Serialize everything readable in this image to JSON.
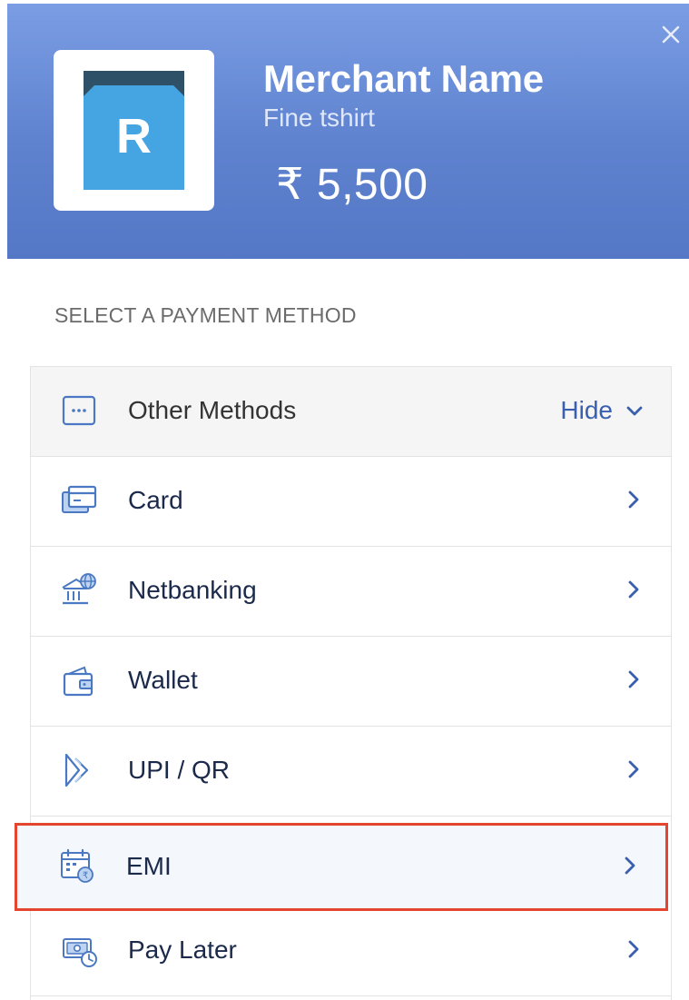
{
  "header": {
    "close_symbol": "×",
    "logo_letter": "R",
    "merchant_name": "Merchant Name",
    "description": "Fine tshirt",
    "amount": "₹ 5,500",
    "colors": {
      "header_start": "#7a9de4",
      "header_end": "#5578c6",
      "logo_blue": "#45a4e2",
      "logo_dark": "#2f5168"
    }
  },
  "section_title": "SELECT A PAYMENT METHOD",
  "other_methods": {
    "label": "Other Methods",
    "toggle_label": "Hide",
    "icon": "more-dots-icon"
  },
  "methods": [
    {
      "label": "Card",
      "icon": "card-icon"
    },
    {
      "label": "Netbanking",
      "icon": "bank-globe-icon"
    },
    {
      "label": "Wallet",
      "icon": "wallet-icon"
    },
    {
      "label": "UPI / QR",
      "icon": "upi-icon"
    },
    {
      "label": "EMI",
      "icon": "emi-calendar-icon",
      "highlighted": true
    },
    {
      "label": "Pay Later",
      "icon": "pay-later-icon"
    }
  ],
  "colors": {
    "label_text": "#1b2a4a",
    "accent": "#3a5fae",
    "icon_blue": "#4a78c2",
    "icon_light": "#bcd3f1",
    "highlight_border": "#e4452f",
    "divider": "#e3e3e3"
  }
}
